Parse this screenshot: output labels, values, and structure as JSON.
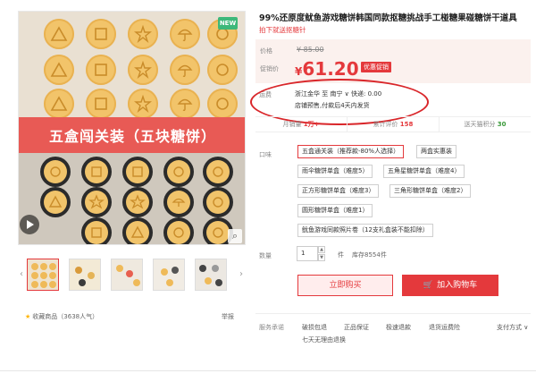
{
  "gallery": {
    "new_badge": "NEW",
    "banner_text": "五盒闯关装（五块糖饼）",
    "zoom_icon": "magnifier-icon",
    "play_icon": "play-icon"
  },
  "product": {
    "title": "99%还原度鱿鱼游戏糖饼韩国同款抠糖挑战手工椪糖果碰糖饼干道具",
    "subtitle": "拍下就送抠糖针"
  },
  "price": {
    "original_label": "价格",
    "original_value": "¥ 85.00",
    "promo_label": "促销价",
    "currency": "¥",
    "promo_value": "61.20",
    "promo_tag": "优惠促销"
  },
  "shipping": {
    "label": "运费",
    "line": "浙江金华  至  南宁 ∨   快递: 0.00",
    "note": "店铺预售,付款后4天内发货"
  },
  "stats": {
    "monthly_sales_label": "月销量",
    "monthly_sales_value": "1万+",
    "reviews_label": "累计评价",
    "reviews_value": "158",
    "points_label": "送天猫积分",
    "points_value": "30"
  },
  "options": {
    "label": "口味",
    "items": [
      "五盒通关装（推荐款-80%人选择）",
      "两盒实惠装",
      "雨伞糖饼单盒（难度5）",
      "五角星糖饼单盒（难度4）",
      "正方形糖饼单盒（难度3）",
      "三角形糖饼单盒（难度2）",
      "圆形糖饼单盒（难度1）",
      "鱿鱼游戏同款照片卷（12支礼盒装不能扣除）"
    ]
  },
  "quantity": {
    "label": "数量",
    "value": "1",
    "unit": "件",
    "stock": "库存8554件"
  },
  "actions": {
    "buy_now": "立即购买",
    "add_to_cart": "加入购物车"
  },
  "service": {
    "label": "服务承诺",
    "items": [
      "破损包退",
      "正品保证",
      "极速退款",
      "退货运费险",
      "七天无理由退换"
    ],
    "payment": "支付方式 ∨"
  },
  "footer": {
    "favorite": "收藏商品",
    "favorite_count": "（3638人气）",
    "report": "举报"
  },
  "colors": {
    "accent": "#e4393c",
    "price_bg": "#fbf1ee",
    "banner": "#e85a55",
    "new_badge": "#3db87a"
  }
}
